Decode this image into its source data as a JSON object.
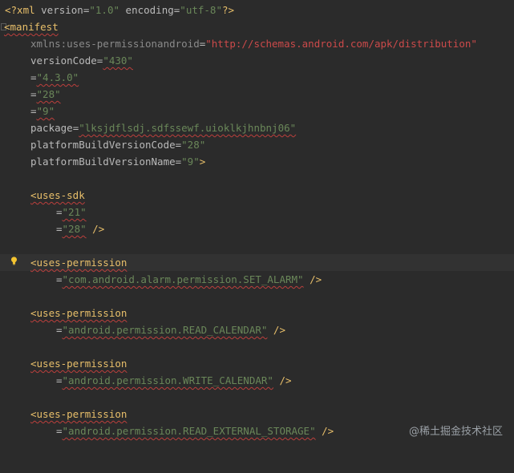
{
  "lines": {
    "l1": {
      "a": "<?xml ",
      "b": "version",
      "c": "=",
      "d": "\"1.0\"",
      "e": " ",
      "f": "encoding",
      "g": "=",
      "h": "\"utf-8\"",
      "i": "?>"
    },
    "l2": {
      "a": "<manifest"
    },
    "l3": {
      "a": "xmlns:uses-permissionandroid",
      "b": "=",
      "c": "\"http://schemas.android.com/apk/distribution\""
    },
    "l4": {
      "a": "versionCode",
      "b": "=",
      "c": "\"430\""
    },
    "l5": {
      "a": "=",
      "b": "\"4.3.0\""
    },
    "l6": {
      "a": "=",
      "b": "\"28\""
    },
    "l7": {
      "a": "=",
      "b": "\"9\""
    },
    "l8": {
      "a": "package",
      "b": "=",
      "c": "\"lksjdflsdj.sdfssewf.uioklkjhnbnj06\""
    },
    "l9": {
      "a": "platformBuildVersionCode",
      "b": "=",
      "c": "\"28\""
    },
    "l10": {
      "a": "platformBuildVersionName",
      "b": "=",
      "c": "\"9\"",
      "d": ">"
    },
    "l11": {
      "a": "<uses-sdk"
    },
    "l12": {
      "a": "=",
      "b": "\"21\""
    },
    "l13": {
      "a": "=",
      "b": "\"28\"",
      "c": " />"
    },
    "l14": {
      "a": "<uses-permission"
    },
    "l15": {
      "a": "=",
      "b": "\"com.android.alarm.permission.SET_ALARM\"",
      "c": " />"
    },
    "l16": {
      "a": "<uses-permission"
    },
    "l17": {
      "a": "=",
      "b": "\"android.permission.READ_CALENDAR\"",
      "c": " />"
    },
    "l18": {
      "a": "<uses-permission"
    },
    "l19": {
      "a": "=",
      "b": "\"android.permission.WRITE_CALENDAR\"",
      "c": " />"
    },
    "l20": {
      "a": "<uses-permission"
    },
    "l21": {
      "a": "=",
      "b": "\"android.permission.READ_EXTERNAL_STORAGE\"",
      "c": " />"
    }
  },
  "watermark": "@稀土掘金技术社区",
  "icons": {
    "fold": "fold-marker-icon",
    "intention": "lightbulb-icon"
  },
  "colors": {
    "background": "#2b2b2b",
    "tag": "#e8bf6a",
    "string": "#6a8759",
    "error_underline": "#bc3f3c"
  }
}
